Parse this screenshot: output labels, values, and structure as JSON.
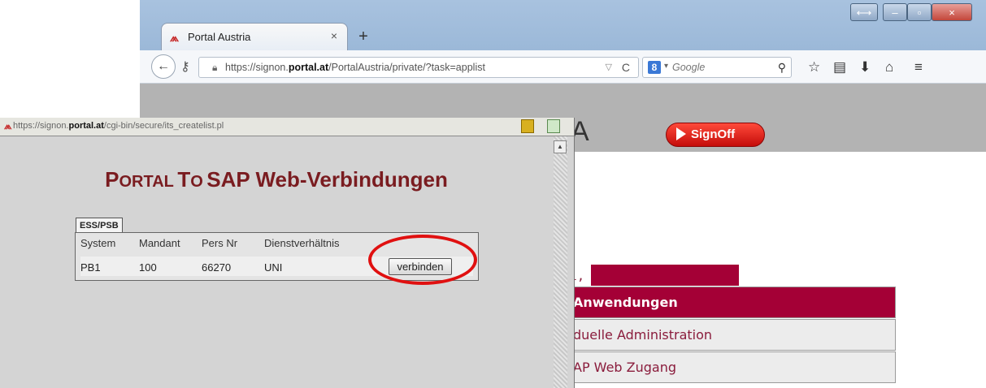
{
  "browser": {
    "tab_title": "Portal Austria",
    "tab_close": "×",
    "new_tab": "+",
    "url_prefix": "https://signon.",
    "url_domain": "portal.at",
    "url_suffix": "/PortalAustria/private/?task=applist",
    "search_placeholder": "Google",
    "search_engine_letter": "8",
    "toolbar_icons": [
      "bookmark-star-icon",
      "reading-list-icon",
      "downloads-icon",
      "home-icon",
      "menu-icon"
    ]
  },
  "page": {
    "logo_fragment": "A",
    "signoff_label": "SignOff",
    "greeting_fragment": "al,",
    "menu": [
      {
        "label": "Anwendungen",
        "active": true
      },
      {
        "label": "duelle Administration",
        "active": false
      },
      {
        "label": "AP Web Zugang",
        "active": false
      }
    ]
  },
  "popup": {
    "url_prefix": "https://signon.",
    "url_domain": "portal.at",
    "url_suffix": "/cgi-bin/secure/its_createlist.pl",
    "title_p": "P",
    "title_ortal": "ORTAL",
    "title_to_t": "T",
    "title_to_o": "O",
    "title_rest": "SAP Web-Verbindungen",
    "tab_label": "ESS/PSB",
    "columns": [
      "System",
      "Mandant",
      "Pers Nr",
      "Dienstverhältnis"
    ],
    "row": {
      "system": "PB1",
      "mandant": "100",
      "pers_nr": "66270",
      "dienstverhaeltnis": "UNI"
    },
    "button_label": "verbinden"
  },
  "colors": {
    "accent": "#a40036",
    "popup_title": "#7a1c20",
    "signoff": "#d01010",
    "highlight_ellipse": "#e01010"
  }
}
